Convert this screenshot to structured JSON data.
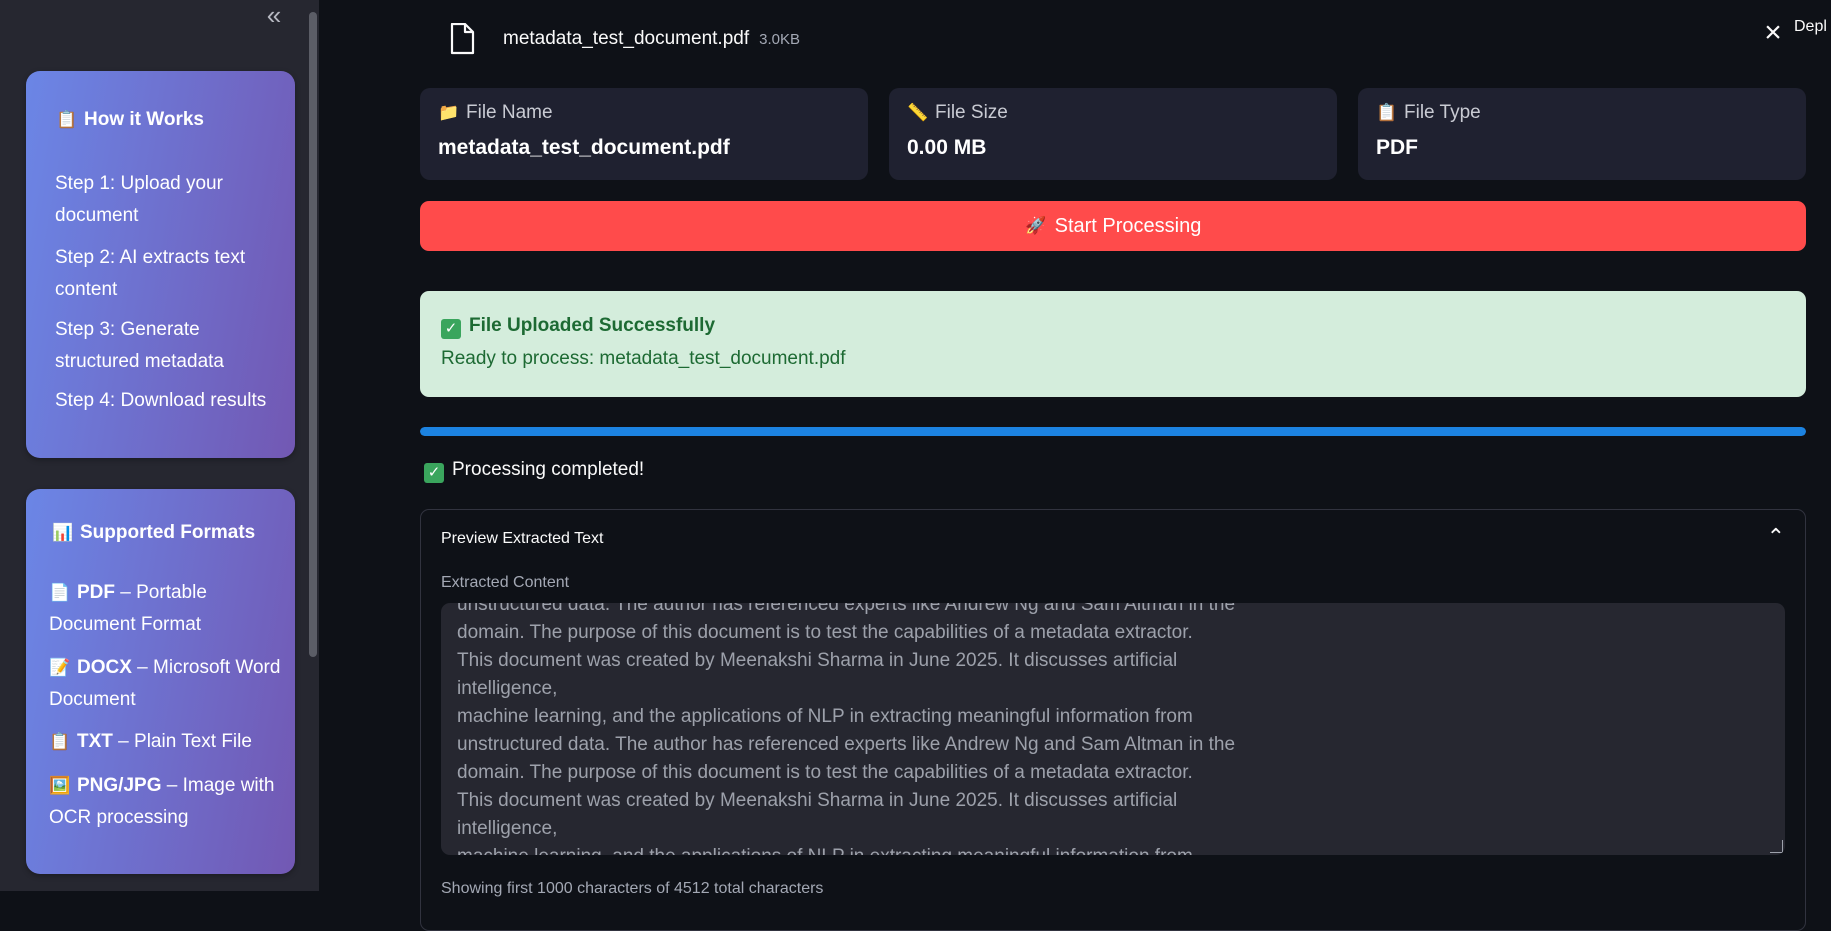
{
  "sidebar": {
    "collapse_icon": "«",
    "how_it_works": {
      "icon": "📋",
      "title": "How it Works",
      "steps": [
        "Step 1: Upload your document",
        "Step 2: AI extracts text content",
        "Step 3: Generate structured metadata",
        "Step 4: Download results"
      ]
    },
    "supported_formats": {
      "icon": "📊",
      "title": "Supported Formats",
      "formats": [
        {
          "icon": "📄",
          "name": "PDF",
          "desc": " – Portable Document Format"
        },
        {
          "icon": "📝",
          "name": "DOCX",
          "desc": " – Microsoft Word Document"
        },
        {
          "icon": "📋",
          "name": "TXT",
          "desc": " – Plain Text File"
        },
        {
          "icon": "🖼️",
          "name": "PNG/JPG",
          "desc": " – Image with OCR processing"
        }
      ]
    }
  },
  "uploaded_file": {
    "name": "metadata_test_document.pdf",
    "size": "3.0KB"
  },
  "header": {
    "close_icon": "×",
    "deploy_label": "Depl"
  },
  "metrics": [
    {
      "icon": "📁",
      "label": "File Name",
      "value": "metadata_test_document.pdf"
    },
    {
      "icon": "📏",
      "label": "File Size",
      "value": "0.00 MB"
    },
    {
      "icon": "📋",
      "label": "File Type",
      "value": "PDF"
    }
  ],
  "start_button": {
    "icon": "🚀",
    "label": "Start Processing"
  },
  "success": {
    "icon": "✓",
    "title": "File Uploaded Successfully",
    "text": "Ready to process: metadata_test_document.pdf"
  },
  "progress": {
    "value": 1.0,
    "color": "#1c83e1"
  },
  "processing_status": {
    "icon": "✓",
    "text": "Processing completed!"
  },
  "preview": {
    "title": "Preview Extracted Text",
    "textarea_label": "Extracted Content",
    "content": "unstructured data. The author has referenced experts like Andrew Ng and Sam Altman in the\ndomain. The purpose of this document is to test the capabilities of a metadata extractor.\nThis document was created by Meenakshi Sharma in June 2025. It discusses artificial intelligence,\nmachine learning, and the applications of NLP in extracting meaningful information from\nunstructured data. The author has referenced experts like Andrew Ng and Sam Altman in the\ndomain. The purpose of this document is to test the capabilities of a metadata extractor.\nThis document was created by Meenakshi Sharma in June 2025. It discusses artificial intelligence,\nmachine learning, and the applications of NLP in extracting meaningful information from\nunstructured data. The author has referenced expe...",
    "caption": "Showing first 1000 characters of 4512 total characters"
  },
  "colors": {
    "background": "#0e1117",
    "sidebar": "#262730",
    "primary_button": "#ff4b4b",
    "success_bg": "#d4eddc",
    "success_text": "#1d6a33",
    "card_gradient_start": "#6b86e6",
    "card_gradient_end": "#7258b3"
  }
}
